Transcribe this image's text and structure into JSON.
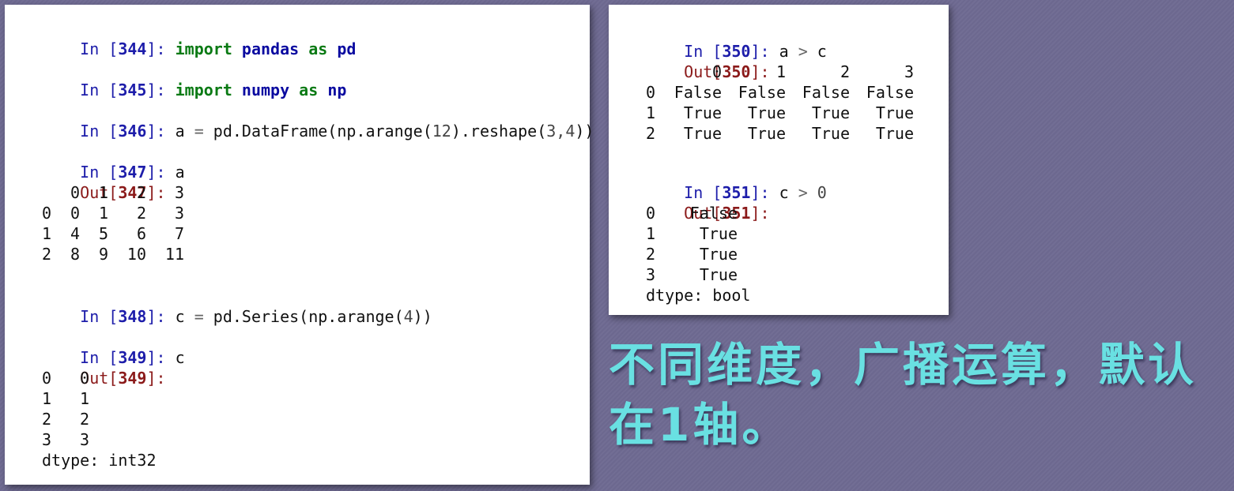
{
  "left": {
    "cells": [
      {
        "prompt": "In [",
        "num": "344",
        "close": "]:",
        "kw1": "import",
        "mod": "pandas",
        "kw2": "as",
        "alias": "pd"
      },
      {
        "prompt": "In [",
        "num": "345",
        "close": "]:",
        "kw1": "import",
        "mod": "numpy",
        "kw2": "as",
        "alias": "np"
      }
    ],
    "cell346": {
      "prompt": "In [",
      "num": "346",
      "close": "]:",
      "code_a": "a ",
      "eq": "=",
      "code_b": " pd.DataFrame(np.arange(",
      "n": "12",
      "code_c": ").reshape(",
      "args": "3,4",
      "code_d": "))"
    },
    "cell347": {
      "prompt": "In [",
      "num": "347",
      "close": "]:",
      "code": "a",
      "out_prompt": "Out[",
      "out_num": "347",
      "out_close": "]:"
    },
    "df_a": {
      "columns": [
        "0",
        "1",
        "2",
        "3"
      ],
      "rows": [
        {
          "index": "0",
          "values": [
            "0",
            "1",
            "2",
            "3"
          ]
        },
        {
          "index": "1",
          "values": [
            "4",
            "5",
            "6",
            "7"
          ]
        },
        {
          "index": "2",
          "values": [
            "8",
            "9",
            "10",
            "11"
          ]
        }
      ]
    },
    "cell348": {
      "prompt": "In [",
      "num": "348",
      "close": "]:",
      "code_a": "c ",
      "eq": "=",
      "code_b": " pd.Series(np.arange(",
      "n": "4",
      "code_c": "))"
    },
    "cell349": {
      "prompt": "In [",
      "num": "349",
      "close": "]:",
      "code": "c",
      "out_prompt": "Out[",
      "out_num": "349",
      "out_close": "]:"
    },
    "series_c": {
      "rows": [
        {
          "index": "0",
          "value": "0"
        },
        {
          "index": "1",
          "value": "1"
        },
        {
          "index": "2",
          "value": "2"
        },
        {
          "index": "3",
          "value": "3"
        }
      ],
      "dtype": "dtype: int32"
    }
  },
  "right": {
    "cell350": {
      "prompt": "In [",
      "num": "350",
      "close": "]:",
      "code_a": "a ",
      "op": ">",
      "code_b": " c",
      "out_prompt": "Out[",
      "out_num": "350",
      "out_close": "]:"
    },
    "df_ac": {
      "columns": [
        "0",
        "1",
        "2",
        "3"
      ],
      "rows": [
        {
          "index": "0",
          "values": [
            "False",
            "False",
            "False",
            "False"
          ]
        },
        {
          "index": "1",
          "values": [
            "True",
            "True",
            "True",
            "True"
          ]
        },
        {
          "index": "2",
          "values": [
            "True",
            "True",
            "True",
            "True"
          ]
        }
      ]
    },
    "cell351": {
      "prompt": "In [",
      "num": "351",
      "close": "]:",
      "code_a": "c ",
      "op": ">",
      "n": " 0",
      "out_prompt": "Out[",
      "out_num": "351",
      "out_close": "]:"
    },
    "series_c0": {
      "rows": [
        {
          "index": "0",
          "value": "False"
        },
        {
          "index": "1",
          "value": "True"
        },
        {
          "index": "2",
          "value": "True"
        },
        {
          "index": "3",
          "value": "True"
        }
      ],
      "dtype": "dtype: bool"
    }
  },
  "caption": {
    "line1": "不同维度，广播运算，默认",
    "line2": "在1轴。"
  },
  "colors": {
    "background": "#6f6a92",
    "caption": "#69e0e2",
    "in_prompt": "#1d1daa",
    "out_prompt": "#8b1a1a",
    "keyword": "#0a7a14"
  }
}
